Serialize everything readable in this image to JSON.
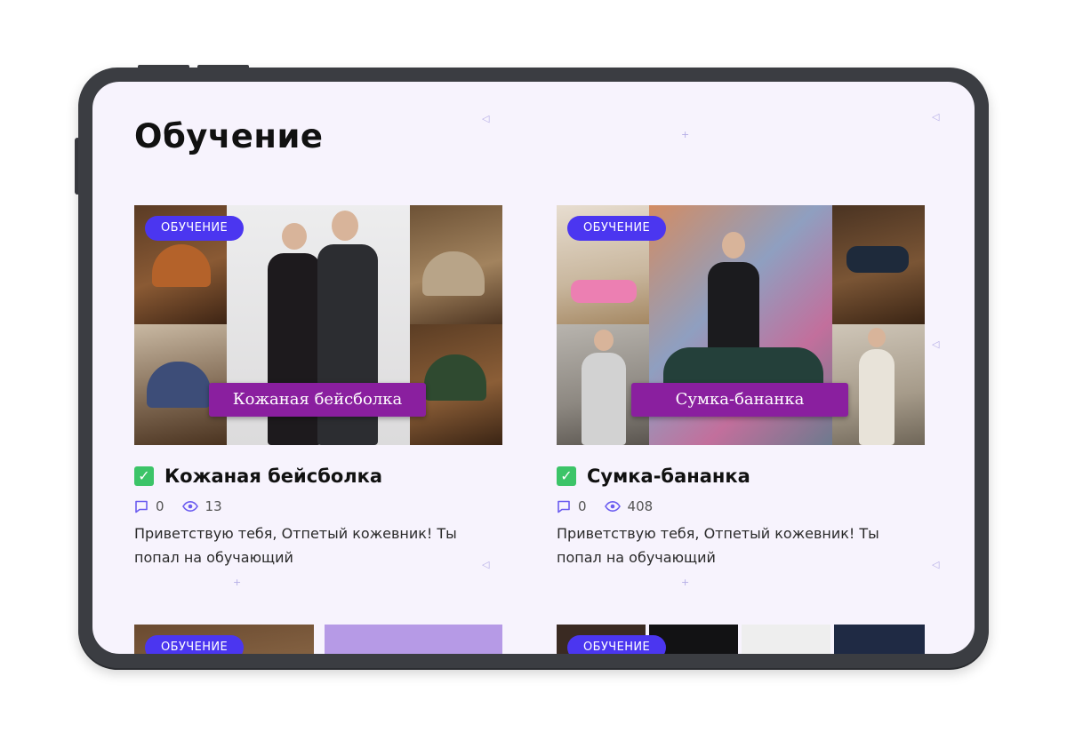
{
  "page": {
    "title": "Обучение"
  },
  "cards": [
    {
      "badge": "ОБУЧЕНИЕ",
      "image_caption": "Кожаная бейсболка",
      "title": "Кожаная бейсболка",
      "completed": true,
      "comments": "0",
      "views": "13",
      "excerpt": "Приветствую тебя, Отпетый кожевник! Ты попал на обучающий"
    },
    {
      "badge": "ОБУЧЕНИЕ",
      "image_caption": "Сумка-бананка",
      "title": "Сумка-бананка",
      "completed": true,
      "comments": "0",
      "views": "408",
      "excerpt": "Приветствую тебя, Отпетый кожевник! Ты попал на обучающий"
    },
    {
      "badge": "ОБУЧЕНИЕ"
    },
    {
      "badge": "ОБУЧЕНИЕ"
    }
  ],
  "colors": {
    "badge": "#4b36f0",
    "banner": "#8a1f9f",
    "check": "#3cc468",
    "meta_icon": "#6b5cf0",
    "screen_bg": "#f7f3fd"
  },
  "icons": {
    "completed": "checkbox-checked-icon",
    "comments": "comment-icon",
    "views": "eye-icon"
  }
}
